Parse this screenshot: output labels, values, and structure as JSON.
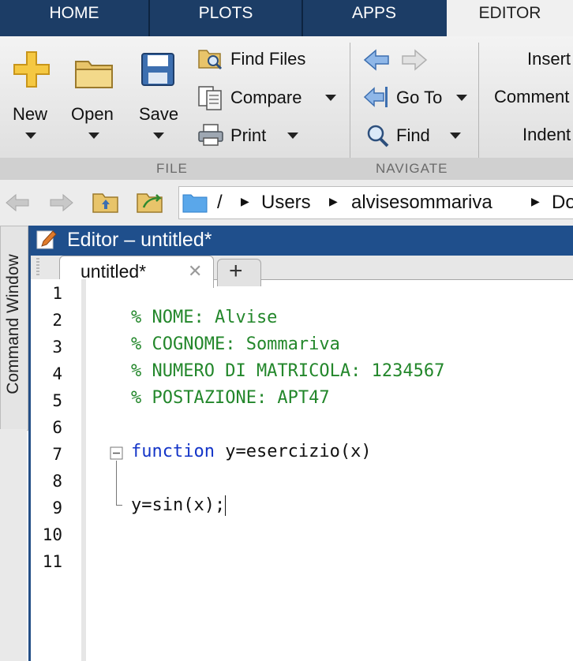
{
  "top_tabs": [
    "HOME",
    "PLOTS",
    "APPS",
    "EDITOR"
  ],
  "ribbon": {
    "new_label": "New",
    "open_label": "Open",
    "save_label": "Save",
    "find_files_label": "Find Files",
    "compare_label": "Compare",
    "print_label": "Print",
    "go_to_label": "Go To",
    "find_label": "Find",
    "insert_label": "Insert",
    "comment_label": "Comment",
    "indent_label": "Indent",
    "section_file": "FILE",
    "section_navigate": "NAVIGATE"
  },
  "path": {
    "root": "/",
    "segments": [
      "Users",
      "alvisesommariva",
      "Do"
    ]
  },
  "side_panel_label": "Command Window",
  "editor": {
    "title": "Editor – untitled*",
    "tab_label": "untitled*",
    "add_tab_label": "+",
    "line_numbers": [
      "1",
      "2",
      "3",
      "4",
      "5",
      "6",
      "7",
      "8",
      "9",
      "10",
      "11"
    ],
    "lines": {
      "l2": "% NOME: Alvise",
      "l3": "% COGNOME: Sommariva",
      "l4": "% NUMERO DI MATRICOLA: 1234567",
      "l5": "% POSTAZIONE: APT47",
      "l7_kw": "function",
      "l7_rest": " y=esercizio(x)",
      "l9": "y=sin(x);"
    }
  },
  "colors": {
    "tab_bar": "#1c3d66",
    "editor_title": "#1f4f8c",
    "comment": "#23872b",
    "keyword": "#1435c8"
  }
}
